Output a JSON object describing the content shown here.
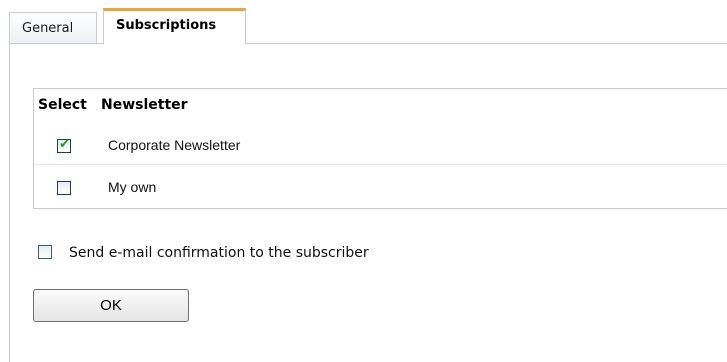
{
  "tabs": [
    {
      "label": "General",
      "active": false
    },
    {
      "label": "Subscriptions",
      "active": true
    }
  ],
  "table": {
    "headers": {
      "select": "Select",
      "newsletter": "Newsletter"
    },
    "rows": [
      {
        "label": "Corporate Newsletter",
        "checked": true
      },
      {
        "label": "My own",
        "checked": false
      }
    ]
  },
  "confirmation": {
    "label": "Send e-mail confirmation to the subscriber",
    "checked": false
  },
  "ok_button": {
    "label": "OK"
  },
  "colors": {
    "active_tab_accent": "#f0a13a",
    "check_mark": "#21a121"
  }
}
